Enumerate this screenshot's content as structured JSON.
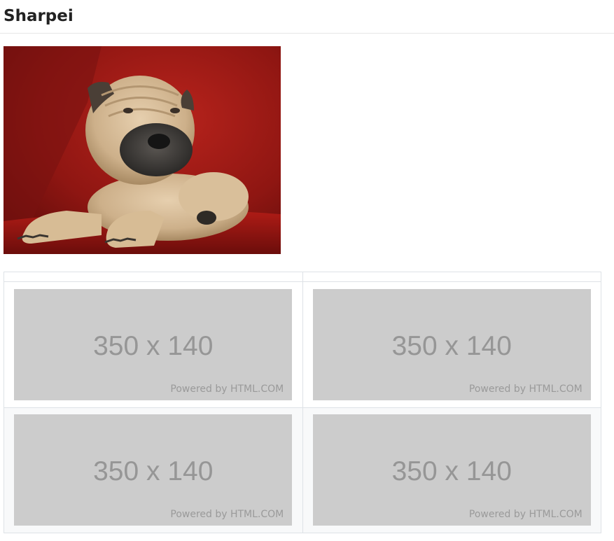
{
  "page": {
    "title": "Sharpei"
  },
  "hero_image": {
    "subject": "Shar Pei puppy on red leather couch"
  },
  "grid": {
    "header": [
      "",
      ""
    ],
    "rows": [
      {
        "cells": [
          {
            "size_text": "350 x 140",
            "credit": "Powered by HTML.COM"
          },
          {
            "size_text": "350 x 140",
            "credit": "Powered by HTML.COM"
          }
        ]
      },
      {
        "cells": [
          {
            "size_text": "350 x 140",
            "credit": "Powered by HTML.COM"
          },
          {
            "size_text": "350 x 140",
            "credit": "Powered by HTML.COM"
          }
        ]
      }
    ]
  },
  "colors": {
    "placeholder_bg": "#cccccc",
    "placeholder_text": "#969696",
    "table_border": "#dee2e6",
    "stripe": "#f8f9fa"
  }
}
